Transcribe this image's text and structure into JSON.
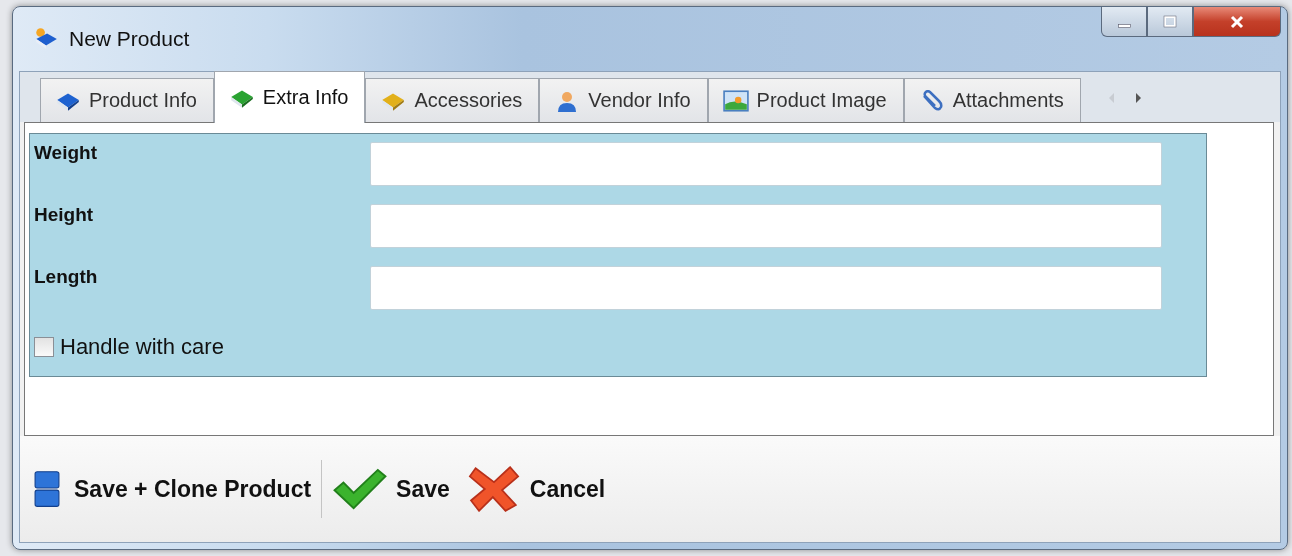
{
  "window": {
    "title": "New Product"
  },
  "tabs": [
    {
      "label": "Product Info",
      "selected": false,
      "kind": "book-blue"
    },
    {
      "label": "Extra Info",
      "selected": true,
      "kind": "book-green"
    },
    {
      "label": "Accessories",
      "selected": false,
      "kind": "book-yellow"
    },
    {
      "label": "Vendor Info",
      "selected": false,
      "kind": "person"
    },
    {
      "label": "Product Image",
      "selected": false,
      "kind": "image"
    },
    {
      "label": "Attachments",
      "selected": false,
      "kind": "clip"
    }
  ],
  "fields": [
    {
      "label": "Weight"
    },
    {
      "label": "Height"
    },
    {
      "label": "Length"
    }
  ],
  "checkbox": {
    "label": "Handle with care",
    "checked": false
  },
  "buttons": [
    {
      "label": "Save + Clone Product",
      "kind": "clone"
    },
    {
      "label": "Save",
      "kind": "save"
    },
    {
      "label": "Cancel",
      "kind": "cancel"
    }
  ]
}
